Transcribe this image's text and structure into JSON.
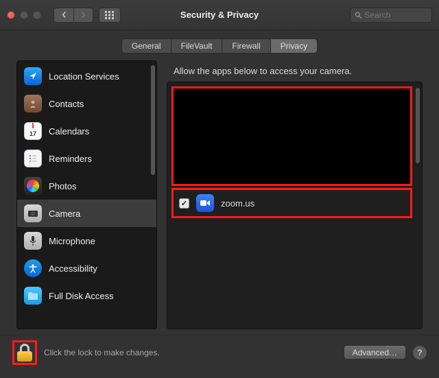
{
  "window": {
    "title": "Security & Privacy"
  },
  "search": {
    "placeholder": "Search"
  },
  "tabs": [
    {
      "label": "General"
    },
    {
      "label": "FileVault"
    },
    {
      "label": "Firewall"
    },
    {
      "label": "Privacy"
    }
  ],
  "active_tab_index": 3,
  "sidebar": {
    "items": [
      {
        "label": "Location Services"
      },
      {
        "label": "Contacts"
      },
      {
        "label": "Calendars"
      },
      {
        "label": "Reminders"
      },
      {
        "label": "Photos"
      },
      {
        "label": "Camera"
      },
      {
        "label": "Microphone"
      },
      {
        "label": "Accessibility"
      },
      {
        "label": "Full Disk Access"
      }
    ],
    "selected_index": 5,
    "calendar_day": "17"
  },
  "main": {
    "header": "Allow the apps below to access your camera.",
    "apps": [
      {
        "name": "zoom.us",
        "checked": true
      }
    ]
  },
  "footer": {
    "lock_text": "Click the lock to make changes.",
    "advanced_label": "Advanced…",
    "help_label": "?"
  }
}
